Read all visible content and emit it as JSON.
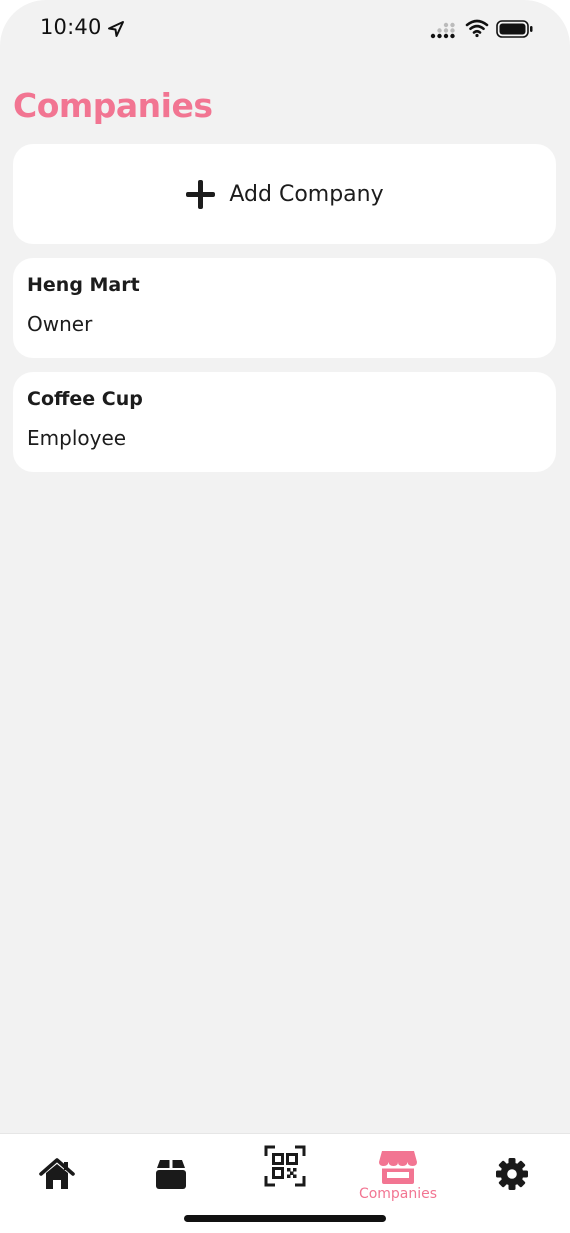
{
  "status_bar": {
    "time": "10:40"
  },
  "header": {
    "title": "Companies"
  },
  "add_company": {
    "label": "Add Company"
  },
  "companies": [
    {
      "name": "Heng Mart",
      "role": "Owner"
    },
    {
      "name": "Coffee Cup",
      "role": "Employee"
    }
  ],
  "tab_bar": {
    "tabs": [
      {
        "icon": "home-icon",
        "label": ""
      },
      {
        "icon": "box-icon",
        "label": ""
      },
      {
        "icon": "qr-scan-icon",
        "label": ""
      },
      {
        "icon": "store-icon",
        "label": "Companies",
        "active": true
      },
      {
        "icon": "gear-icon",
        "label": ""
      }
    ]
  },
  "colors": {
    "accent": "#f27592",
    "background": "#f2f2f2",
    "card": "#ffffff",
    "text": "#1c1c1c"
  }
}
